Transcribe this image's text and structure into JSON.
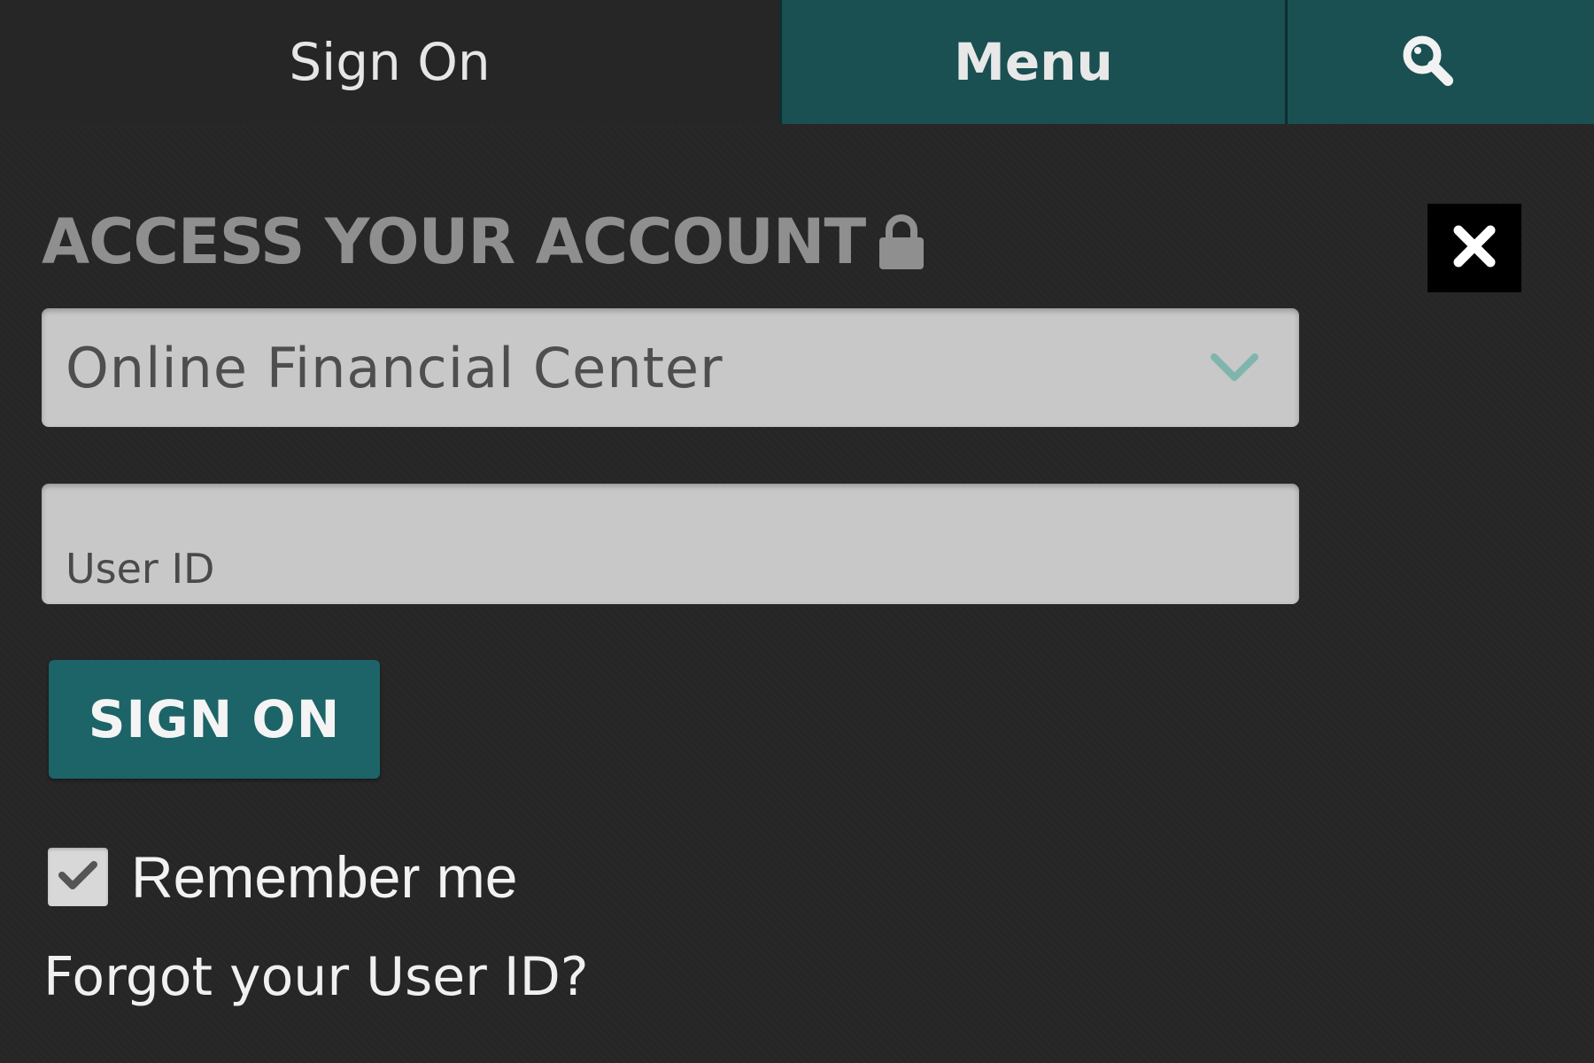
{
  "nav": {
    "signon_tab": "Sign On",
    "menu_tab": "Menu",
    "search_icon": "search-icon"
  },
  "panel": {
    "heading": "ACCESS YOUR ACCOUNT",
    "lock_icon": "lock-icon",
    "close_icon": "close-icon"
  },
  "form": {
    "account_type_selected": "Online Financial Center",
    "user_id_placeholder": "User ID",
    "user_id_value": "",
    "signon_button": "SIGN ON",
    "remember_me_label": "Remember me",
    "remember_me_checked": true,
    "forgot_link": "Forgot your User ID?"
  },
  "colors": {
    "background": "#262626",
    "accent": "#1a5052",
    "button": "#1c6467",
    "field": "#c8c8c8",
    "chevron": "#7fb5ac"
  }
}
